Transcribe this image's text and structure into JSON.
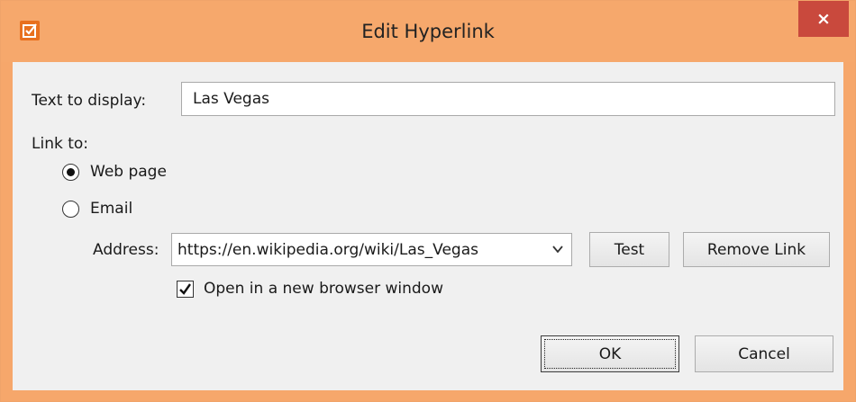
{
  "window": {
    "title": "Edit Hyperlink",
    "close_glyph": "×",
    "app_icon": "checkbox-app-icon",
    "accent_color": "#f6a86c",
    "close_color": "#c9493d"
  },
  "form": {
    "text_to_display_label": "Text to display:",
    "text_to_display_value": "Las Vegas",
    "link_to_label": "Link to:",
    "web_page_label": "Web page",
    "email_label": "Email",
    "selected_link_type": "Web page",
    "address_label": "Address:",
    "address_value": "https://en.wikipedia.org/wiki/Las_Vegas",
    "test_button": "Test",
    "remove_link_button": "Remove Link",
    "new_window_label": "Open in a new browser window",
    "new_window_checked": true
  },
  "footer": {
    "ok_button": "OK",
    "cancel_button": "Cancel"
  }
}
